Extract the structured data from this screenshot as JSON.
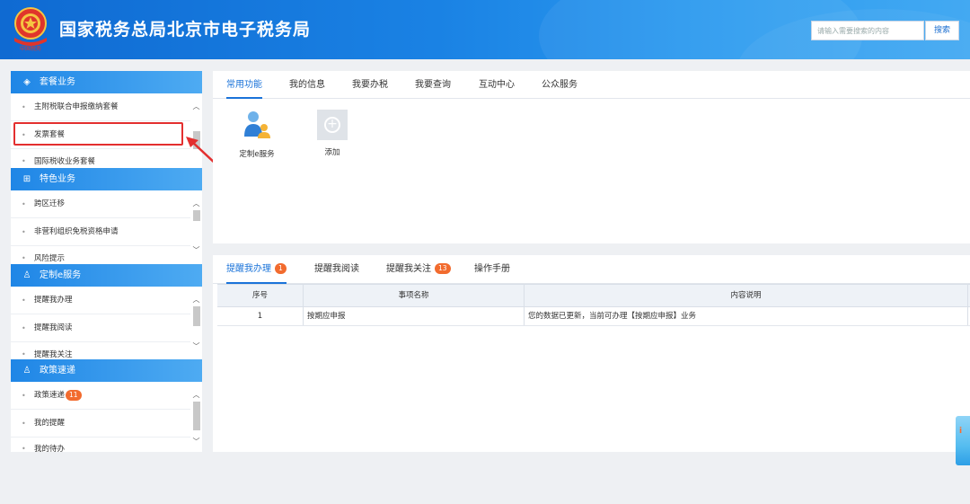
{
  "header": {
    "title": "国家税务总局北京市电子税务局",
    "emblem_caption": "中国税务",
    "search_placeholder": "请输入需要搜索的内容",
    "search_button": "搜索"
  },
  "sidebar": {
    "sections": [
      {
        "title": "套餐业务",
        "icon": "layers-icon",
        "items": [
          "主附税联合申报缴纳套餐",
          "发票套餐",
          "国际税收业务套餐"
        ]
      },
      {
        "title": "特色业务",
        "icon": "grid-icon",
        "items": [
          "跨区迁移",
          "非营利组织免税资格申请",
          "风险提示"
        ]
      },
      {
        "title": "定制e服务",
        "icon": "user-icon",
        "items": [
          "提醒我办理",
          "提醒我阅读",
          "提醒我关注"
        ]
      },
      {
        "title": "政策速递",
        "icon": "user-icon",
        "items": [
          "政策速递",
          "我的提醒",
          "我的待办"
        ],
        "badge": "11"
      }
    ]
  },
  "top_tabs": [
    "常用功能",
    "我的信息",
    "我要办税",
    "我要查询",
    "互动中心",
    "公众服务"
  ],
  "functions": [
    "定制e服务",
    "添加"
  ],
  "bottom_tabs": [
    {
      "label": "提醒我办理",
      "badge": "1"
    },
    {
      "label": "提醒我阅读",
      "badge": ""
    },
    {
      "label": "提醒我关注",
      "badge": "13"
    },
    {
      "label": "操作手册",
      "badge": ""
    }
  ],
  "table": {
    "columns": [
      "序号",
      "事项名称",
      "内容说明"
    ],
    "rows": [
      {
        "index": "1",
        "name": "按期应申报",
        "desc": "您的数据已更新，当前可办理【按期应申报】业务"
      }
    ]
  },
  "colors": {
    "accent": "#1a73d9",
    "highlight": "#e32f2f",
    "badge": "#f26b2e"
  }
}
